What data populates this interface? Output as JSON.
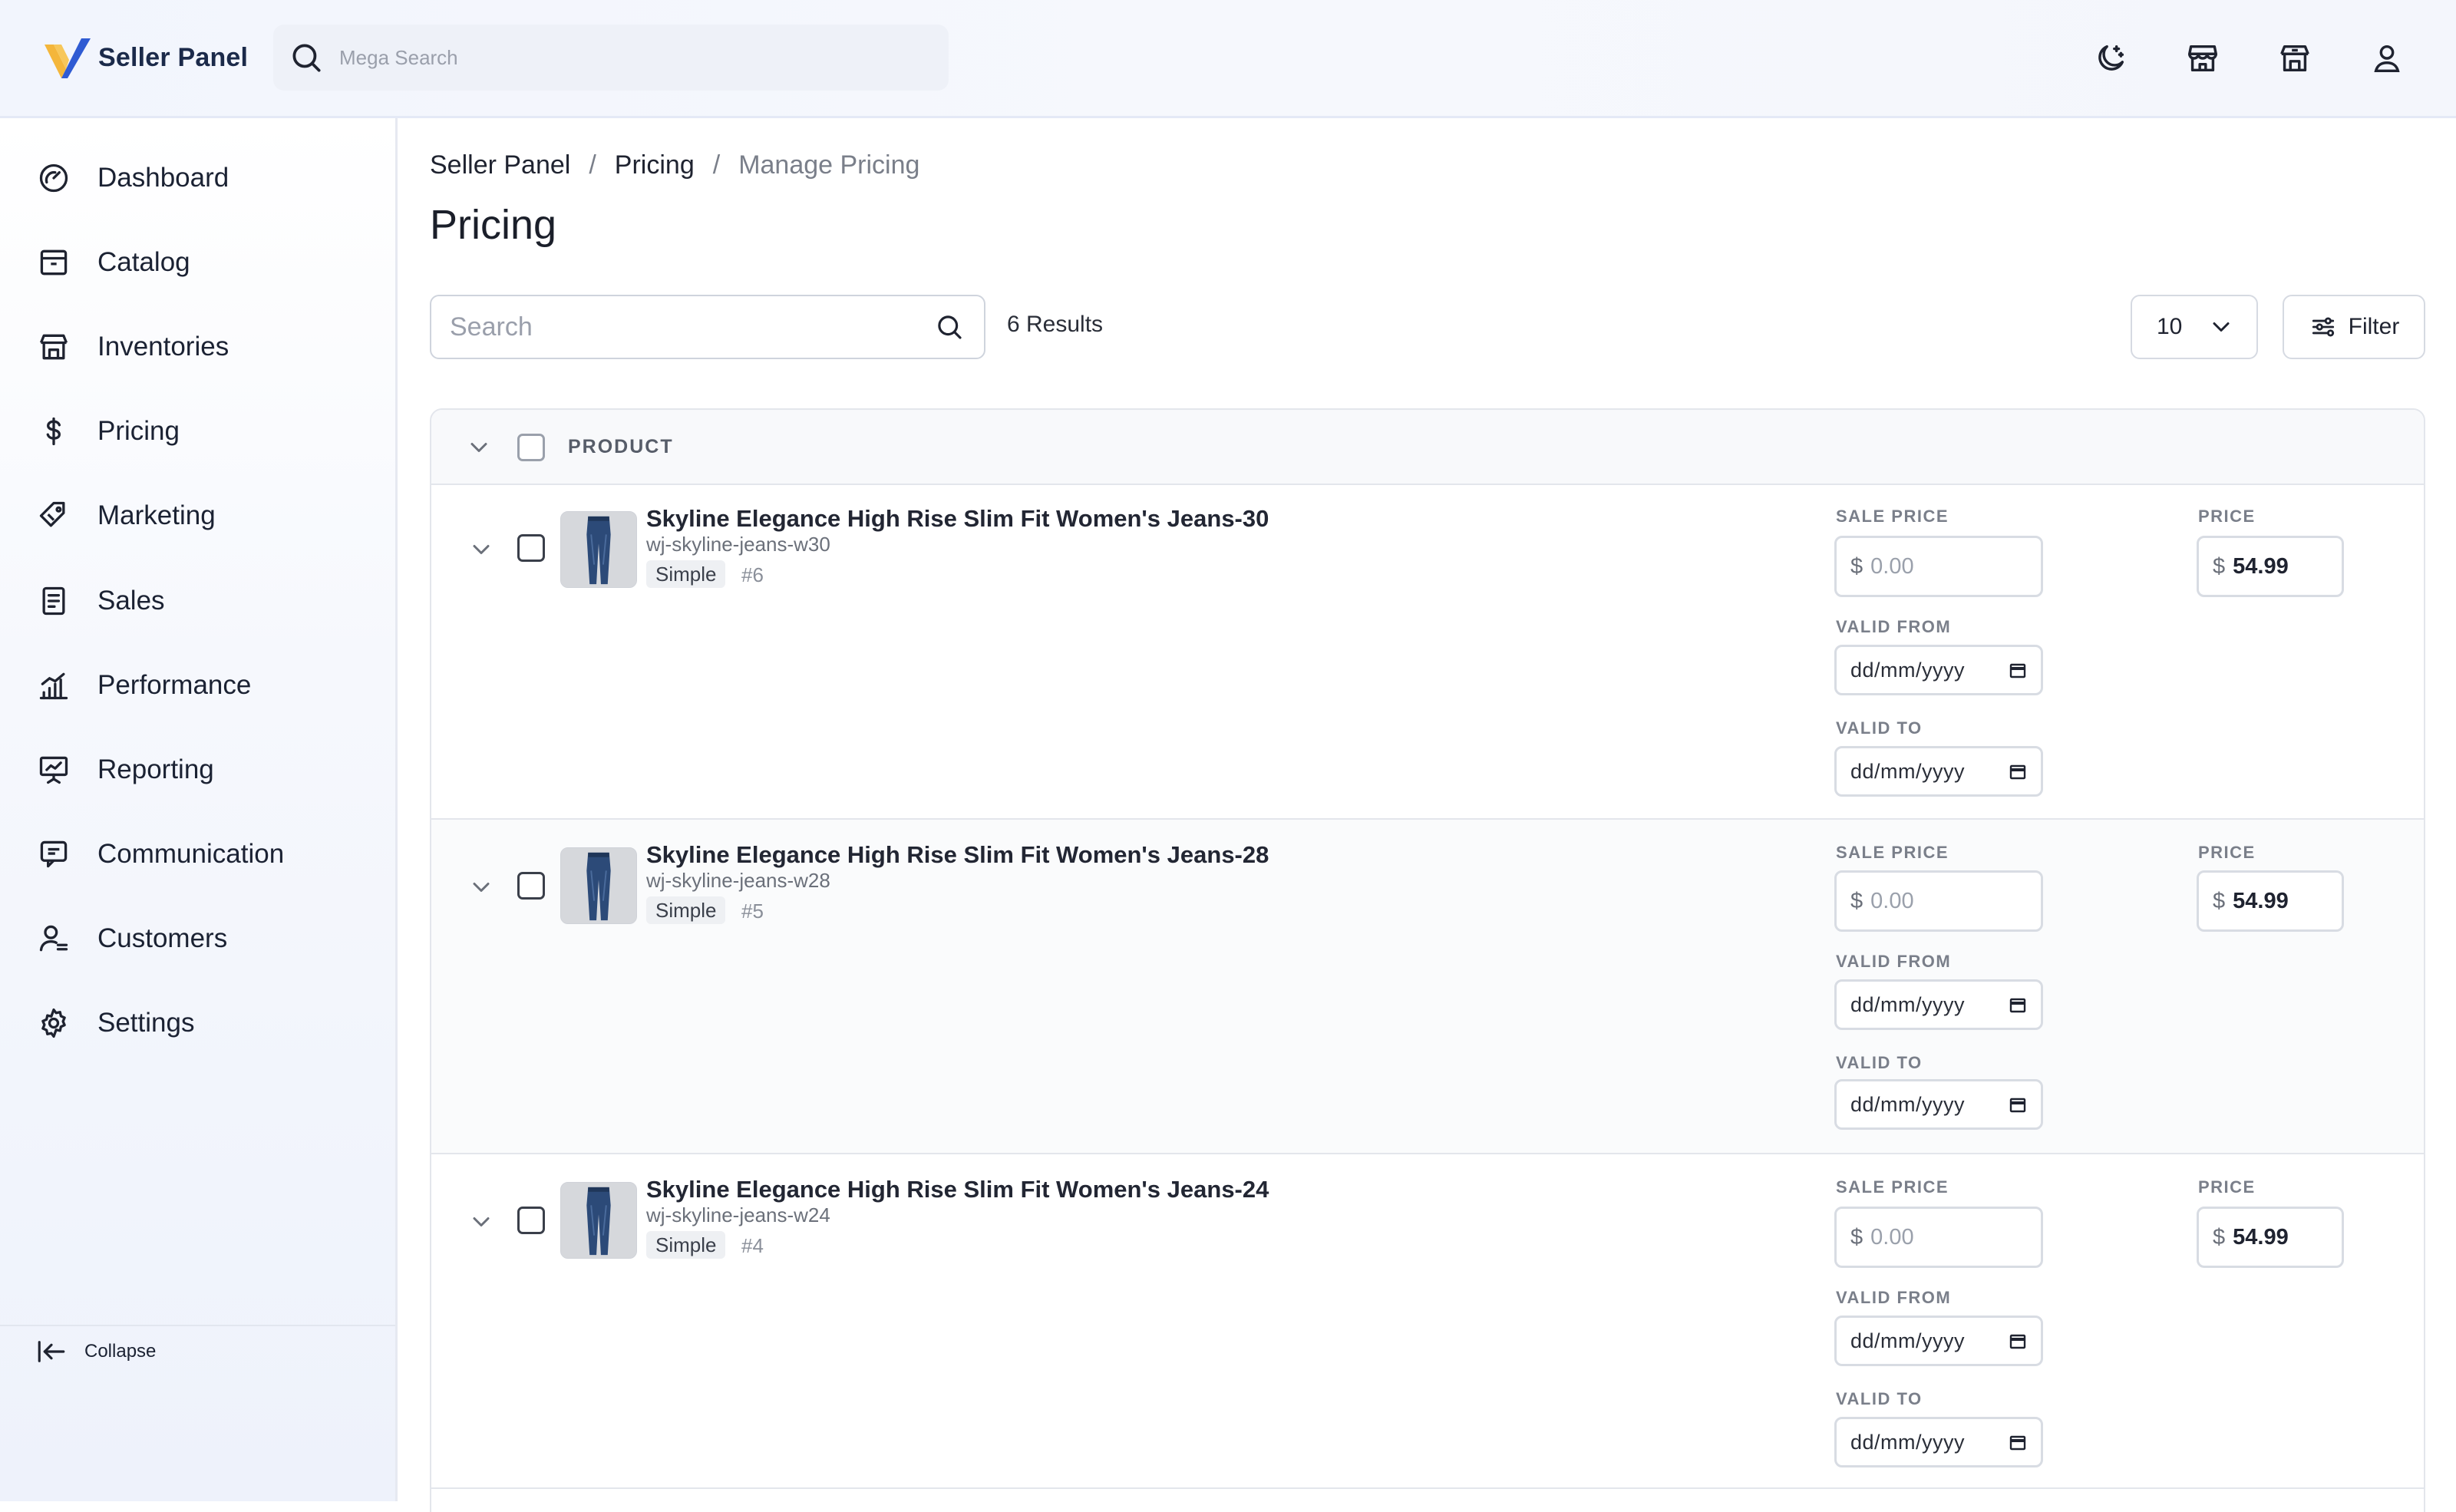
{
  "app": {
    "name": "Seller Panel",
    "mega_search_placeholder": "Mega Search",
    "top_icons": [
      "theme-toggle-icon",
      "storefront-icon",
      "warehouse-icon",
      "user-icon"
    ]
  },
  "sidebar": {
    "items": [
      {
        "label": "Dashboard",
        "icon": "dashboard-icon"
      },
      {
        "label": "Catalog",
        "icon": "catalog-icon"
      },
      {
        "label": "Inventories",
        "icon": "inventories-icon"
      },
      {
        "label": "Pricing",
        "icon": "dollar-icon"
      },
      {
        "label": "Marketing",
        "icon": "tag-icon"
      },
      {
        "label": "Sales",
        "icon": "receipt-icon"
      },
      {
        "label": "Performance",
        "icon": "bar-chart-icon"
      },
      {
        "label": "Reporting",
        "icon": "presentation-icon"
      },
      {
        "label": "Communication",
        "icon": "chat-icon"
      },
      {
        "label": "Customers",
        "icon": "customers-icon"
      },
      {
        "label": "Settings",
        "icon": "gear-icon"
      }
    ],
    "collapse_label": "Collapse"
  },
  "breadcrumb": [
    "Seller Panel",
    "Pricing",
    "Manage Pricing"
  ],
  "page_title": "Pricing",
  "toolbar": {
    "search_placeholder": "Search",
    "results_text": "6 Results",
    "page_size": "10",
    "filter_label": "Filter"
  },
  "table": {
    "header_label": "PRODUCT",
    "field_labels": {
      "sale_price": "SALE PRICE",
      "price": "PRICE",
      "valid_from": "VALID FROM",
      "valid_to": "VALID TO"
    },
    "currency_symbol": "$",
    "sale_price_placeholder": "0.00",
    "date_placeholder": "dd/mm/yyyy",
    "rows": [
      {
        "name": "Skyline Elegance High Rise Slim Fit Women's Jeans-30",
        "sku": "wj-skyline-jeans-w30",
        "type": "Simple",
        "id": "#6",
        "price": "54.99"
      },
      {
        "name": "Skyline Elegance High Rise Slim Fit Women's Jeans-28",
        "sku": "wj-skyline-jeans-w28",
        "type": "Simple",
        "id": "#5",
        "price": "54.99"
      },
      {
        "name": "Skyline Elegance High Rise Slim Fit Women's Jeans-24",
        "sku": "wj-skyline-jeans-w24",
        "type": "Simple",
        "id": "#4",
        "price": "54.99"
      }
    ]
  }
}
